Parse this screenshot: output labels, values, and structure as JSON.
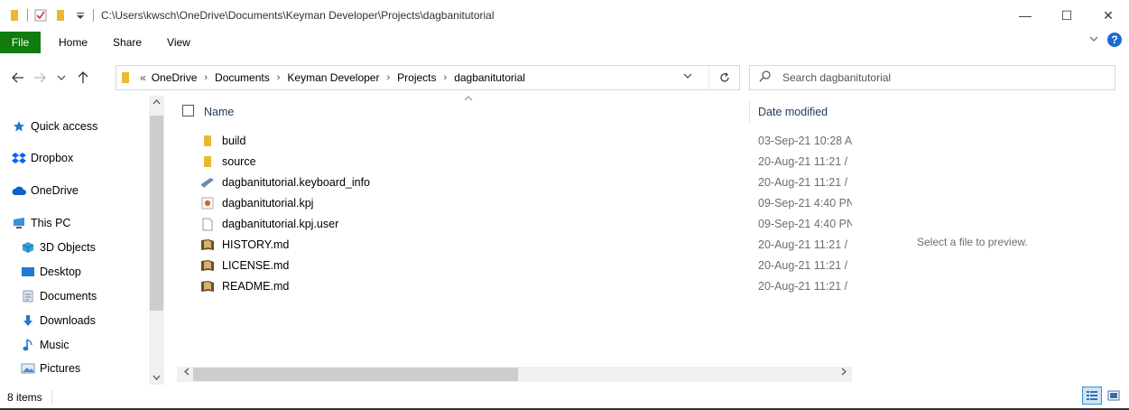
{
  "window": {
    "title_path": "C:\\Users\\kwsch\\OneDrive\\Documents\\Keyman Developer\\Projects\\dagbanitutorial",
    "minimize_glyph": "—",
    "maximize_glyph": "☐",
    "close_glyph": "✕"
  },
  "ribbon": {
    "file_label": "File",
    "tabs": [
      "Home",
      "Share",
      "View"
    ],
    "help_glyph": "?"
  },
  "address": {
    "overflow": "«",
    "crumbs": [
      "OneDrive",
      "Documents",
      "Keyman Developer",
      "Projects",
      "dagbanitutorial"
    ]
  },
  "search": {
    "placeholder": "Search dagbanitutorial"
  },
  "nav": {
    "items": [
      {
        "label": "Quick access",
        "icon": "star-icon"
      },
      {
        "label": "Dropbox",
        "icon": "dropbox-icon"
      },
      {
        "label": "OneDrive",
        "icon": "cloud-icon"
      },
      {
        "label": "This PC",
        "icon": "pc-icon"
      },
      {
        "label": "3D Objects",
        "icon": "cube-icon"
      },
      {
        "label": "Desktop",
        "icon": "desktop-icon"
      },
      {
        "label": "Documents",
        "icon": "documents-icon"
      },
      {
        "label": "Downloads",
        "icon": "download-icon"
      },
      {
        "label": "Music",
        "icon": "music-icon"
      },
      {
        "label": "Pictures",
        "icon": "pictures-icon"
      }
    ]
  },
  "files": {
    "header_name": "Name",
    "header_date": "Date modified",
    "rows": [
      {
        "name": "build",
        "date": "03-Sep-21 10:28 A",
        "icon": "folder-icon"
      },
      {
        "name": "source",
        "date": "20-Aug-21 11:21 /",
        "icon": "folder-icon"
      },
      {
        "name": "dagbanitutorial.keyboard_info",
        "date": "20-Aug-21 11:21 /",
        "icon": "file-icon"
      },
      {
        "name": "dagbanitutorial.kpj",
        "date": "09-Sep-21 4:40 PN",
        "icon": "kpj-icon"
      },
      {
        "name": "dagbanitutorial.kpj.user",
        "date": "09-Sep-21 4:40 PN",
        "icon": "blank-file-icon"
      },
      {
        "name": "HISTORY.md",
        "date": "20-Aug-21 11:21 /",
        "icon": "md-icon"
      },
      {
        "name": "LICENSE.md",
        "date": "20-Aug-21 11:21 /",
        "icon": "md-icon"
      },
      {
        "name": "README.md",
        "date": "20-Aug-21 11:21 /",
        "icon": "md-icon"
      }
    ]
  },
  "preview": {
    "message": "Select a file to preview."
  },
  "status": {
    "count": "8 items"
  },
  "colors": {
    "file_tab": "#107c10",
    "folder": "#e8b932",
    "accent": "#1c6bd4"
  }
}
